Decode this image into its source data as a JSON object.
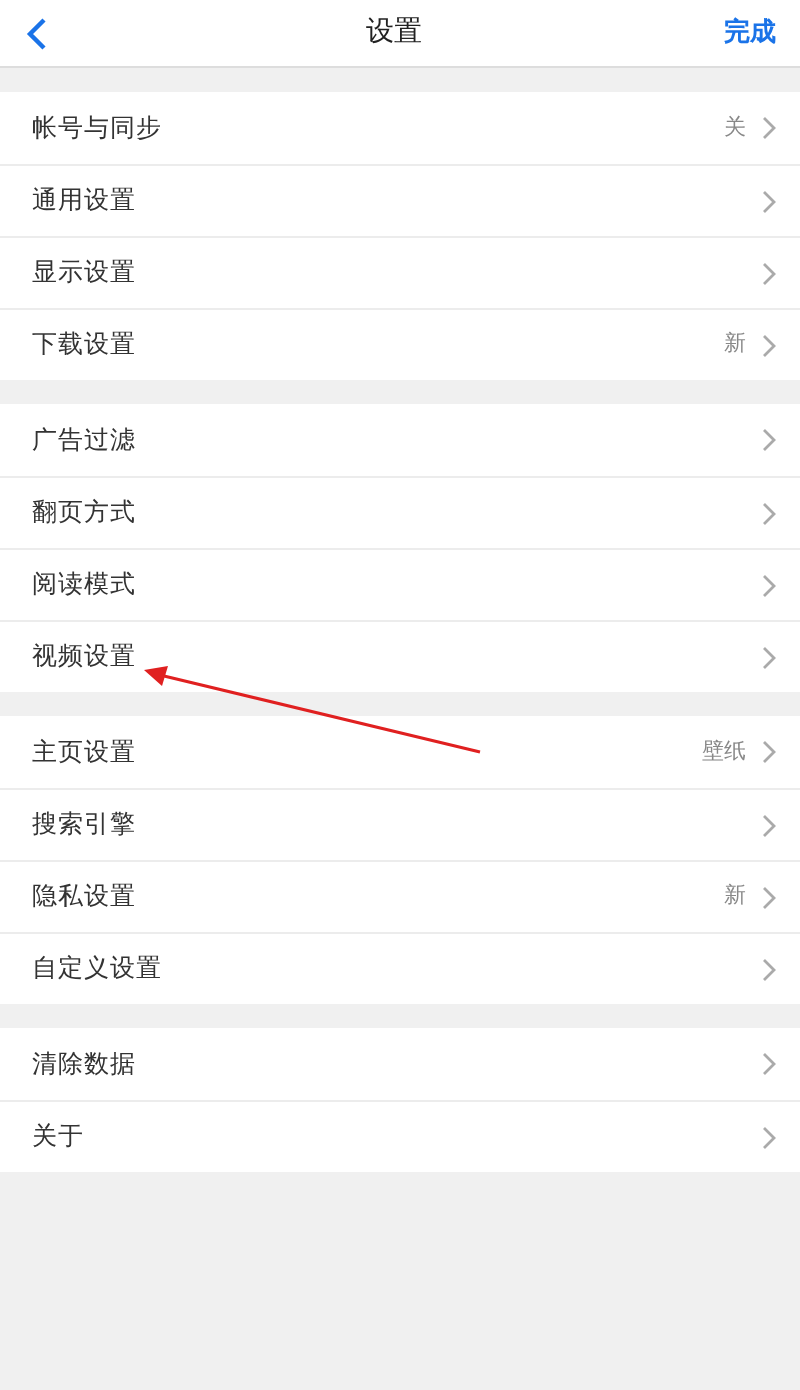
{
  "header": {
    "title": "设置",
    "action": "完成"
  },
  "sections": [
    {
      "items": [
        {
          "label": "帐号与同步",
          "value": "关"
        },
        {
          "label": "通用设置"
        },
        {
          "label": "显示设置"
        },
        {
          "label": "下载设置",
          "value": "新"
        }
      ]
    },
    {
      "items": [
        {
          "label": "广告过滤"
        },
        {
          "label": "翻页方式"
        },
        {
          "label": "阅读模式"
        },
        {
          "label": "视频设置"
        }
      ]
    },
    {
      "items": [
        {
          "label": "主页设置",
          "value": "壁纸"
        },
        {
          "label": "搜索引擎"
        },
        {
          "label": "隐私设置",
          "value": "新"
        },
        {
          "label": "自定义设置"
        }
      ]
    },
    {
      "items": [
        {
          "label": "清除数据"
        },
        {
          "label": "关于"
        }
      ]
    }
  ]
}
